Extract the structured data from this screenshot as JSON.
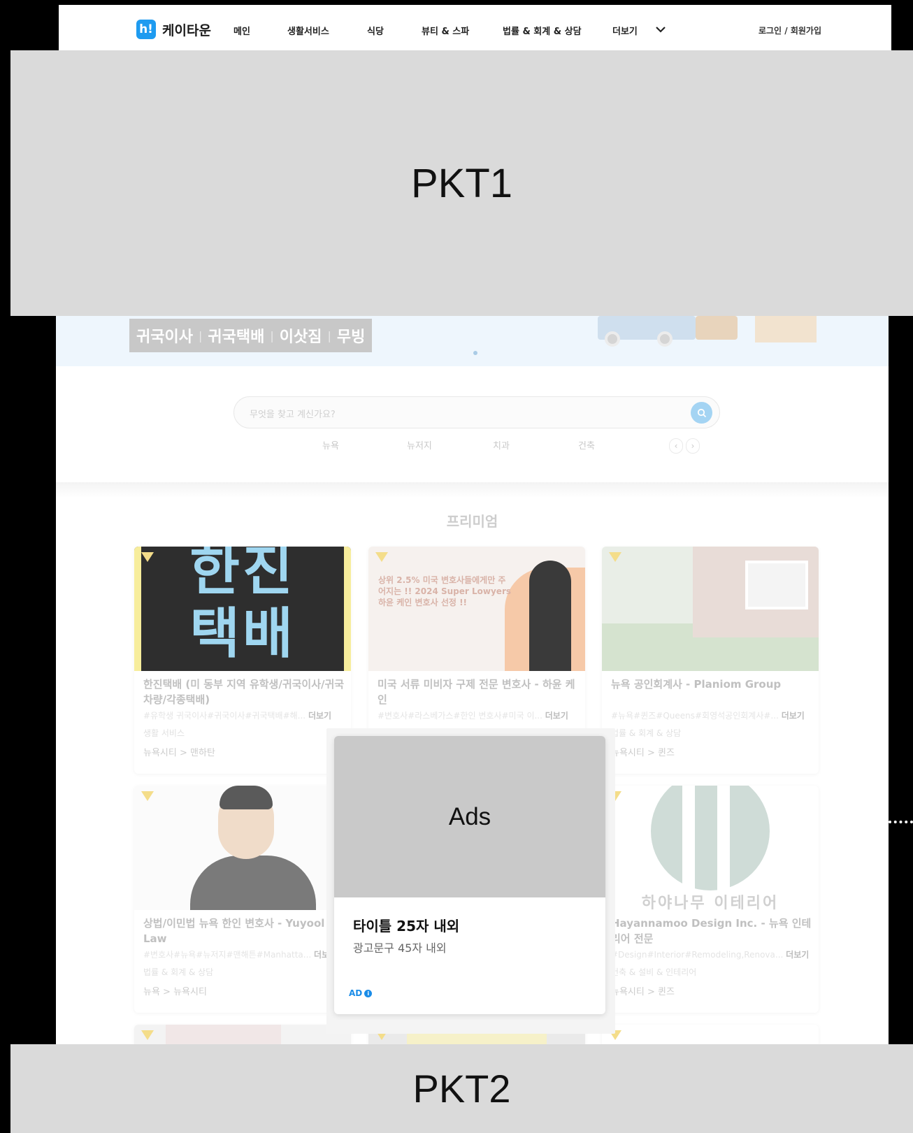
{
  "header": {
    "logo_mark": "h!",
    "logo_text": "케이타운",
    "nav": [
      "메인",
      "생활서비스",
      "식당",
      "뷰티 & 스파",
      "법률 & 회계 & 상담",
      "더보기"
    ],
    "login": "로그인 / 회원가입"
  },
  "placeholders": {
    "top": "PKT1",
    "bottom": "PKT2"
  },
  "banner": {
    "words": [
      "귀국이사",
      "귀국택배",
      "이삿짐",
      "무빙"
    ]
  },
  "search": {
    "placeholder": "무엇을 찾고 계신가요?",
    "chips": [
      "뉴욕",
      "뉴저지",
      "치과",
      "건축"
    ]
  },
  "premium": {
    "title": "프리미엄",
    "more_label": "더보기",
    "cards": [
      {
        "title": "한진택배 (미 동부 지역 유학생/귀국이사/귀국차량/각종택배)",
        "tags": "#유학생 귀국이사#귀국이사#귀국택배#해...",
        "category": "생활 서비스",
        "location": "뉴욕시티 > 맨하탄",
        "image_text": "한진 택배"
      },
      {
        "title": "미국 서류 미비자 구제 전문 변호사 - 하윤 케인",
        "tags": "#변호사#라스베가스#한인 변호사#미국 이...",
        "category": "",
        "location": "",
        "image_text": "상위 2.5% 미국 변호사들에게만 주어지는 !! 2024 Super Lowyers 하윤 케인 변호사 선정 !!"
      },
      {
        "title": "뉴욕 공인회계사 - Planiom Group",
        "tags": "#뉴욕#퀸즈#Queens#회영석공인회계사#...",
        "category": "법률 & 회계 & 상담",
        "location": "뉴욕시티 > 퀸즈",
        "image_text": ""
      },
      {
        "title": "상법/이민법 뉴욕 한인 변호사 - Yuyool Law",
        "tags": "#변호사#뉴욕#뉴저지#맨해튼#Manhatta...",
        "category": "법률 & 회계 & 상담",
        "location": "뉴욕 > 뉴욕시티",
        "image_text": ""
      },
      {
        "title": "Hayannamoo Design Inc. - 뉴욕 인테리어 전문",
        "tags": "#Design#Interior#Remodeling,Renova...",
        "category": "건축 & 설비 & 인테리어",
        "location": "뉴욕시티 > 퀸즈",
        "image_text": "하야나무 이테리어"
      }
    ]
  },
  "ad": {
    "image_label": "Ads",
    "title": "타이틀 25자 내외",
    "description": "광고문구 45자 내외",
    "badge": "AD",
    "info_glyph": "i"
  },
  "colors": {
    "accent": "#1e9bf0",
    "ad_badge": "#1a8ce8",
    "placeholder": "#dadada"
  }
}
